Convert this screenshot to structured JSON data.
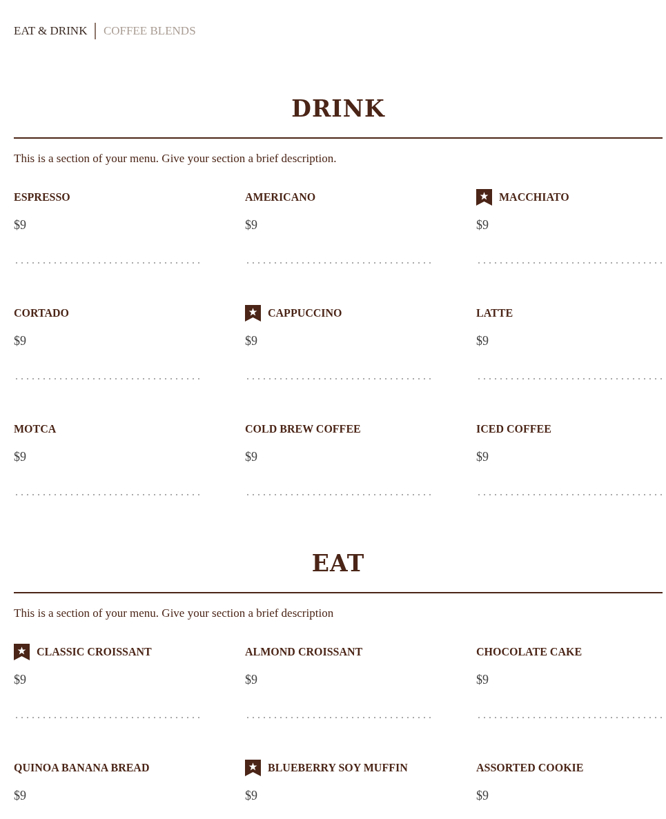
{
  "nav": [
    {
      "label": "EAT & DRINK",
      "selected": true
    },
    {
      "label": "COFFEE BLENDS",
      "selected": false
    }
  ],
  "sections": [
    {
      "title": "DRINK",
      "description": "This is a section of your menu. Give your section a brief description.",
      "items": [
        {
          "name": "ESPRESSO",
          "price": "$9",
          "featured": false
        },
        {
          "name": "AMERICANO",
          "price": "$9",
          "featured": false
        },
        {
          "name": "MACCHIATO",
          "price": "$9",
          "featured": true
        },
        {
          "name": "CORTADO",
          "price": "$9",
          "featured": false
        },
        {
          "name": "CAPPUCCINO",
          "price": "$9",
          "featured": true
        },
        {
          "name": "LATTE",
          "price": "$9",
          "featured": false
        },
        {
          "name": "MOTCA",
          "price": "$9",
          "featured": false
        },
        {
          "name": "COLD BREW COFFEE",
          "price": "$9",
          "featured": false
        },
        {
          "name": "ICED COFFEE",
          "price": "$9",
          "featured": false
        }
      ]
    },
    {
      "title": "EAT",
      "description": "This is a section of your menu. Give your section a brief description",
      "items": [
        {
          "name": "CLASSIC CROISSANT",
          "price": "$9",
          "featured": true
        },
        {
          "name": "ALMOND CROISSANT",
          "price": "$9",
          "featured": false
        },
        {
          "name": "CHOCOLATE CAKE",
          "price": "$9",
          "featured": false
        },
        {
          "name": "QUINOA BANANA BREAD",
          "price": "$9",
          "featured": false
        },
        {
          "name": "BLUEBERRY SOY MUFFIN",
          "price": "$9",
          "featured": true
        },
        {
          "name": "ASSORTED COOKIE",
          "price": "$9",
          "featured": false
        }
      ]
    }
  ]
}
